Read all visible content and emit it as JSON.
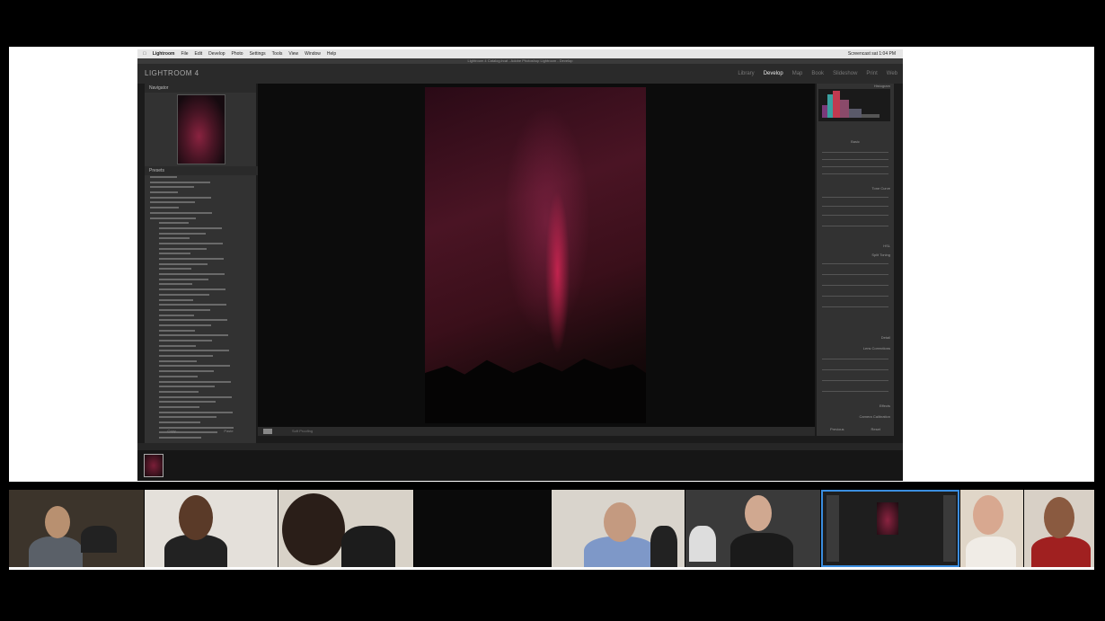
{
  "menubar": {
    "app": "Lightroom",
    "items": [
      "File",
      "Edit",
      "Develop",
      "Photo",
      "Settings",
      "Tools",
      "View",
      "Window",
      "Help"
    ],
    "status": "Screencast  sat 1:04 PM"
  },
  "window_title": "Lightroom 4 Catalog.lrcat - Adobe Photoshop Lightroom - Develop",
  "app_logo": "LIGHTROOM 4",
  "modules": [
    "Library",
    "Develop",
    "Map",
    "Book",
    "Slideshow",
    "Print",
    "Web"
  ],
  "active_module": "Develop",
  "left_panel": {
    "navigator_label": "Navigator",
    "presets_label": "Presets",
    "buttons": [
      "Copy...",
      "Paste"
    ]
  },
  "right_panel": {
    "histogram_label": "Histogram",
    "sections": [
      "Basic",
      "Tone Curve",
      "HSL",
      "Split Toning",
      "Detail",
      "Lens Corrections",
      "Effects",
      "Camera Calibration"
    ],
    "buttons": [
      "Previous",
      "Reset"
    ]
  },
  "toolbar": {
    "soft_proofing": "Soft Proofing"
  },
  "colors": {
    "accent_selected": "#3b8ee0",
    "lr_bg": "#1b1b1b",
    "panel_bg": "#323232"
  },
  "participants_count": 8
}
